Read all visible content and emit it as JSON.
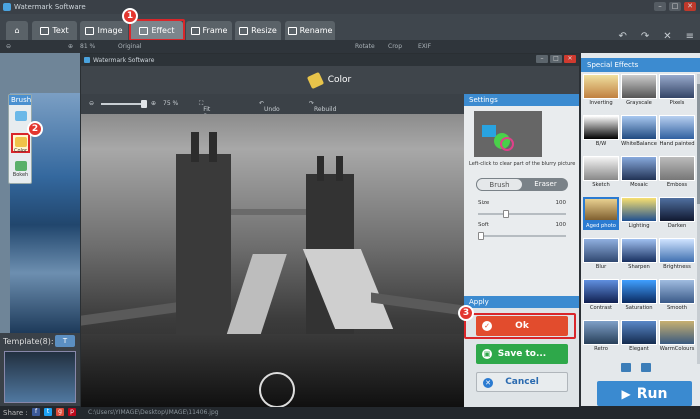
{
  "window": {
    "title": "Watermark Software",
    "min": "–",
    "max": "□",
    "close": "✕"
  },
  "tabs": [
    {
      "label": ""
    },
    {
      "label": "Text"
    },
    {
      "label": "Image"
    },
    {
      "label": "Effect"
    },
    {
      "label": "Frame"
    },
    {
      "label": "Resize"
    },
    {
      "label": "Rename"
    }
  ],
  "badges": {
    "one": "1",
    "two": "2",
    "three": "3"
  },
  "subbar": {
    "zoom": "81 %",
    "original": "Original",
    "rotate": "Rotate",
    "crop": "Crop",
    "exif": "EXIF"
  },
  "brush": {
    "title": "Brush",
    "items": [
      "Color",
      "Bokeh"
    ]
  },
  "templates": {
    "label": "Template(8):",
    "btn": "T"
  },
  "share": {
    "label": "Share :",
    "path": "C:\\Users\\YIMAGE\\Desktop\\IMAGE\\11406.jpg"
  },
  "dialog": {
    "title": "Watermark Software",
    "heading": "Color",
    "zoom": "75 %",
    "fit": "Fit Screen",
    "undo": "Undo",
    "rebuild": "Rebuild"
  },
  "settings": {
    "title": "Settings",
    "desc": "Left-click to clear part of the blurry picture",
    "brush": "Brush",
    "eraser": "Eraser",
    "size_label": "Size",
    "size_value": "100",
    "size_level": 0.3,
    "soft_label": "Soft",
    "soft_value": "100",
    "soft_level": 0.0
  },
  "apply": {
    "title": "Apply",
    "ok": "Ok",
    "save": "Save to...",
    "cancel": "Cancel"
  },
  "effects": {
    "title": "Special Effects",
    "items": [
      "Inverting",
      "Grayscale",
      "Pixels",
      "B/W",
      "WhiteBalance",
      "Hand painted",
      "Sketch",
      "Mosaic",
      "Emboss",
      "Aged photo",
      "Lighting",
      "Darken",
      "Blur",
      "Sharpen",
      "Brightness",
      "Contrast",
      "Saturation",
      "Smooth",
      "Retro",
      "Elegant",
      "WarmColours"
    ],
    "selected": "Aged photo"
  },
  "run": {
    "label": "Run"
  }
}
